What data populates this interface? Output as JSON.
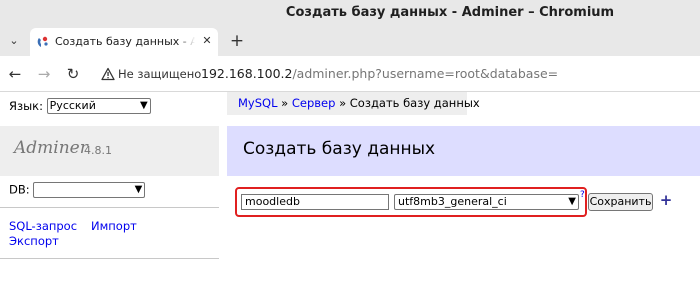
{
  "window": {
    "title": "Создать базу данных - Adminer – Chromium"
  },
  "tab": {
    "title": "Создать базу данных - Adminer"
  },
  "toolbar": {
    "security_label": "Не защищено",
    "url_host": "192.168.100.2",
    "url_path": "/adminer.php?username=root&database="
  },
  "sidebar": {
    "language_label": "Язык:",
    "language_value": "Русский",
    "app_name": "Adminer",
    "app_version": "4.8.1",
    "db_label": "DB:",
    "db_value": "",
    "links": {
      "sql": "SQL-запрос",
      "import": "Импорт",
      "export": "Экспорт"
    }
  },
  "breadcrumb": {
    "driver": "MySQL",
    "sep1": " » ",
    "server": "Сервер",
    "sep2": " » ",
    "current": "Создать базу данных"
  },
  "content": {
    "title": "Создать базу данных",
    "db_name_value": "moodledb",
    "collation_value": "utf8mb3_general_ci",
    "help": "?",
    "save_label": "Сохранить",
    "add_label": "+"
  },
  "colors": {
    "link": "#0000ee",
    "header_bg": "#ddddff",
    "highlight": "#e02020"
  }
}
